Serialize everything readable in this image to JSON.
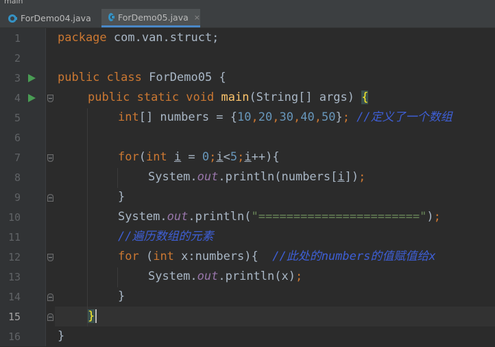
{
  "window": {
    "breadcrumb": "main"
  },
  "tabs": [
    {
      "label": "ForDemo04.java",
      "icon": "java-class-icon",
      "active": false
    },
    {
      "label": "ForDemo05.java",
      "icon": "java-class-icon",
      "active": true,
      "close": "×"
    }
  ],
  "gutter": {
    "line_numbers": [
      "1",
      "2",
      "3",
      "4",
      "5",
      "6",
      "7",
      "8",
      "9",
      "10",
      "11",
      "12",
      "13",
      "14",
      "15",
      "16"
    ],
    "current_line": "15"
  },
  "code": {
    "l1": {
      "kw": "package",
      "rest": " com.van.struct;"
    },
    "l3": {
      "kw1": "public",
      "kw2": "class",
      "name": " ForDemo05 {"
    },
    "l4": {
      "kw": "public static void",
      "fn": "main",
      "args": "(String[] args) ",
      "brace": "{"
    },
    "l5": {
      "kw": "int",
      "a": "[] numbers = {",
      "n1": "10",
      "n2": "20",
      "n3": "30",
      "n4": "40",
      "n5": "50",
      "b": "}",
      "semi": ";",
      "comment": " //定义了一个数组"
    },
    "l7": {
      "kw1": "for",
      "kw2": "int",
      "i1": "i",
      "eq": " = ",
      "n0": "0",
      "semi1": ";",
      "i2": "i",
      "lt": "<",
      "n5": "5",
      "semi2": ";",
      "i3": "i",
      "inc": "++){"
    },
    "l8": {
      "pre": "System.",
      "fld": "out",
      "mid": ".println(numbers[",
      "i": "i",
      "post": "])",
      "semi": ";"
    },
    "l9": {
      "text": "}"
    },
    "l10": {
      "pre": "System.",
      "fld": "out",
      "mid": ".println(",
      "str": "\"=======================\"",
      "post": ")",
      "semi": ";"
    },
    "l11": {
      "comment": "//遍历数组的元素"
    },
    "l12": {
      "kw1": "for",
      "kw2": "int",
      "rest": " x:numbers){  ",
      "comment": "//此处的numbers的值赋值给x"
    },
    "l13": {
      "pre": "System.",
      "fld": "out",
      "mid": ".println(x)",
      "semi": ";"
    },
    "l14": {
      "text": "}"
    },
    "l15": {
      "brace": "}"
    },
    "l16": {
      "text": "}"
    }
  },
  "colors": {
    "background": "#2b2b2b",
    "keyword": "#cc7832",
    "number": "#6897bb",
    "method": "#ffc66d",
    "field": "#9876aa",
    "string": "#6a8759",
    "comment": "#3e5fd6",
    "run_icon": "#499c54"
  }
}
